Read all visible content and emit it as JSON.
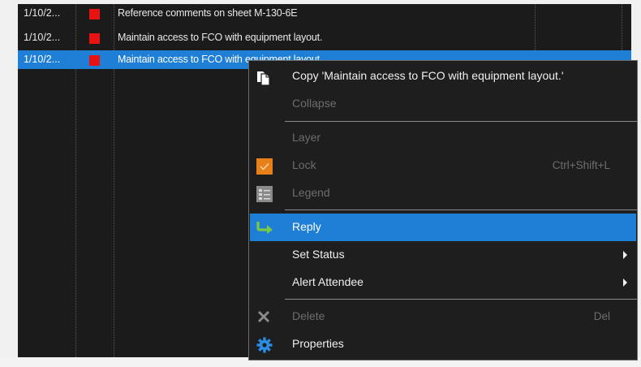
{
  "rows": [
    {
      "date": "1/10/2...",
      "subject": "Reference comments on sheet M-130-6E",
      "status_color": "#e81212",
      "selected": false
    },
    {
      "date": "1/10/2...",
      "subject": "Maintain access to FCO with equipment layout.",
      "status_color": "#e81212",
      "selected": false
    },
    {
      "date": "1/10/2...",
      "subject": "Maintain access to FCO with equipment layout.",
      "status_color": "#e81212",
      "selected": true
    }
  ],
  "context_menu": {
    "copy": {
      "label": "Copy 'Maintain access to FCO with equipment layout.'",
      "icon": "copy-icon"
    },
    "collapse": {
      "label": "Collapse",
      "disabled": true
    },
    "layer": {
      "label": "Layer",
      "disabled": true
    },
    "lock": {
      "label": "Lock",
      "shortcut": "Ctrl+Shift+L",
      "disabled": true,
      "icon": "checkmark-icon"
    },
    "legend": {
      "label": "Legend",
      "disabled": true,
      "icon": "legend-icon"
    },
    "reply": {
      "label": "Reply",
      "highlighted": true,
      "icon": "reply-arrow-icon"
    },
    "set_status": {
      "label": "Set Status",
      "submenu": true
    },
    "alert_attendee": {
      "label": "Alert Attendee",
      "submenu": true
    },
    "delete": {
      "label": "Delete",
      "shortcut": "Del",
      "disabled": true,
      "icon": "delete-x-icon"
    },
    "properties": {
      "label": "Properties",
      "icon": "gear-icon"
    }
  },
  "colors": {
    "selection": "#1f7fd6",
    "status_red": "#e81212",
    "lock_orange": "#e8801a",
    "reply_green": "#7ac943",
    "gear_blue": "#2a8ee6"
  }
}
